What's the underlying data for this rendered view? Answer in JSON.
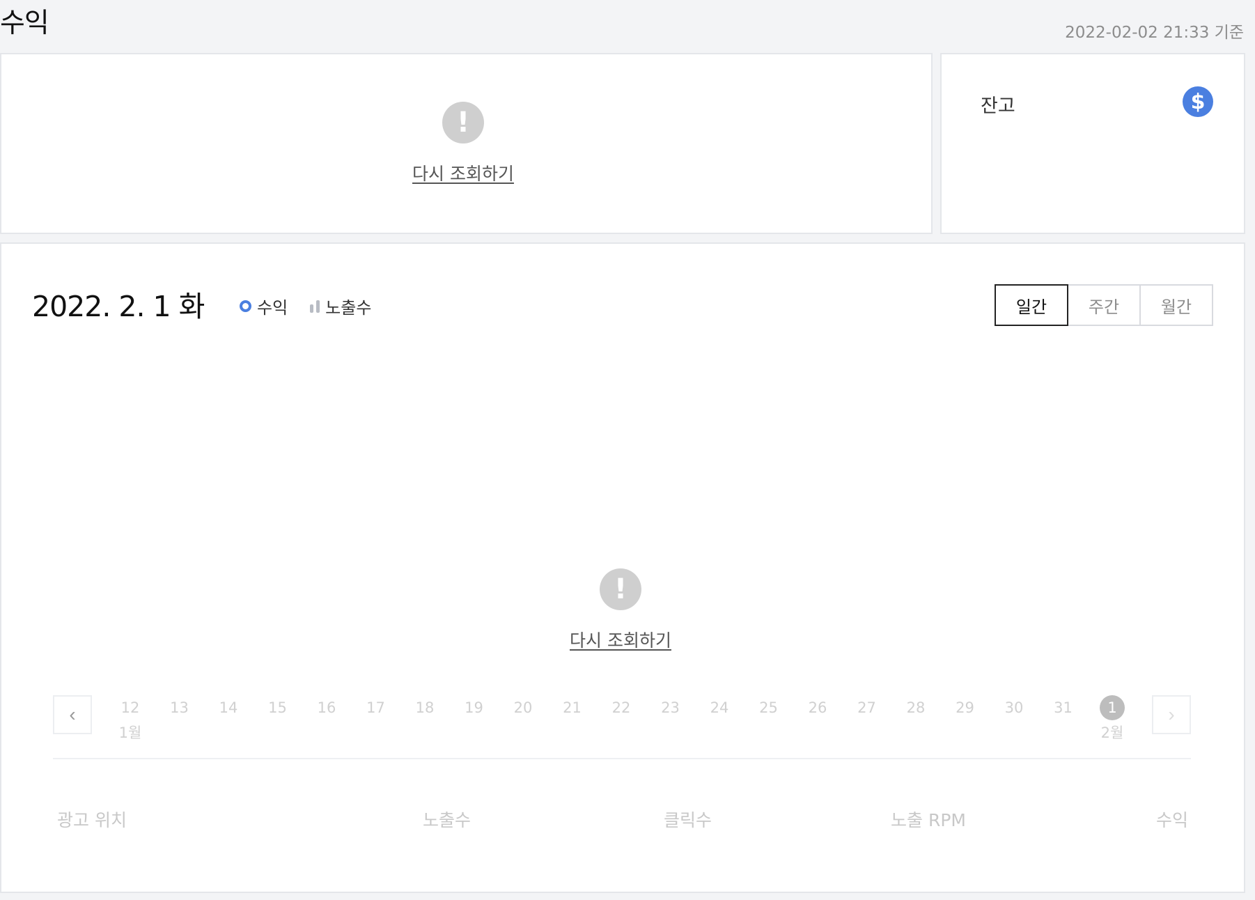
{
  "page": {
    "title": "수익",
    "timestamp": "2022-02-02 21:33 기준"
  },
  "summary_card": {
    "error_icon": "exclamation-icon",
    "retry_label": "다시 조회하기"
  },
  "balance_card": {
    "label": "잔고",
    "icon": "dollar-icon",
    "icon_symbol": "$"
  },
  "chart_card": {
    "date": "2022. 2. 1 화",
    "legend": [
      {
        "label": "수익",
        "icon": "ring-icon",
        "color": "#4a7fe0"
      },
      {
        "label": "노출수",
        "icon": "bars-icon",
        "color": "#b8bcc4"
      }
    ],
    "period_tabs": [
      {
        "label": "일간",
        "active": true
      },
      {
        "label": "주간",
        "active": false
      },
      {
        "label": "월간",
        "active": false
      }
    ],
    "error_icon": "exclamation-icon",
    "retry_label": "다시 조회하기",
    "date_nav": {
      "prev_icon": "‹",
      "next_icon": "›",
      "days": [
        {
          "day": "12",
          "month": "1월"
        },
        {
          "day": "13"
        },
        {
          "day": "14"
        },
        {
          "day": "15"
        },
        {
          "day": "16"
        },
        {
          "day": "17"
        },
        {
          "day": "18"
        },
        {
          "day": "19"
        },
        {
          "day": "20"
        },
        {
          "day": "21"
        },
        {
          "day": "22"
        },
        {
          "day": "23"
        },
        {
          "day": "24"
        },
        {
          "day": "25"
        },
        {
          "day": "26"
        },
        {
          "day": "27"
        },
        {
          "day": "28"
        },
        {
          "day": "29"
        },
        {
          "day": "30"
        },
        {
          "day": "31"
        },
        {
          "day": "1",
          "month": "2월",
          "active": true
        }
      ]
    },
    "table_headers": [
      "광고 위치",
      "노출수",
      "클릭수",
      "노출 RPM",
      "수익"
    ]
  },
  "colors": {
    "accent": "#4a7fe0",
    "background": "#f3f4f6",
    "muted_text": "#8c8c8c"
  }
}
